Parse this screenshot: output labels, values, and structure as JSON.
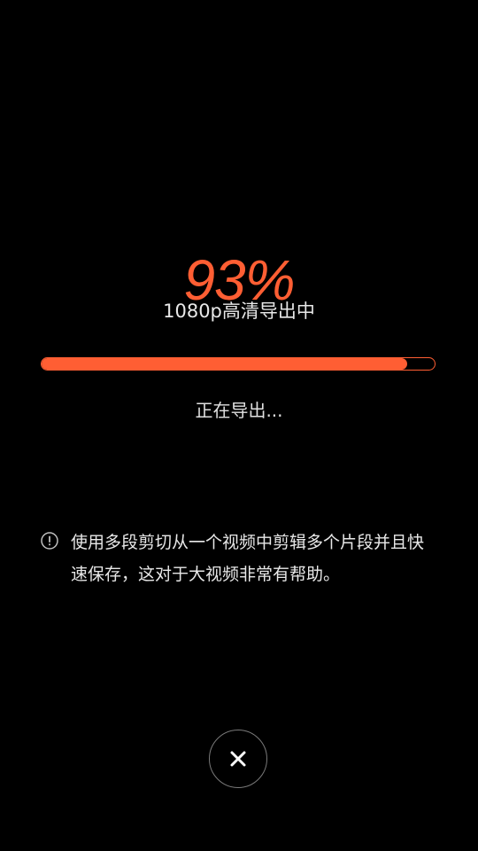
{
  "export": {
    "percent_label": "93%",
    "quality_label": "1080p高清导出中",
    "progress": 0.93,
    "status_label": "正在导出..."
  },
  "tip": {
    "icon": "info-icon",
    "text": "使用多段剪切从一个视频中剪辑多个片段并且快速保存，这对于大视频非常有帮助。"
  },
  "close": {
    "icon": "close-icon"
  },
  "colors": {
    "accent": "#ff5e33",
    "background": "#000000",
    "text": "#e8e8e8",
    "close_border": "#7a7a7a"
  }
}
